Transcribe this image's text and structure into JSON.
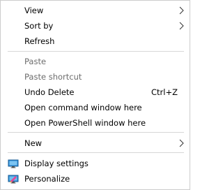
{
  "context_menu": {
    "items": [
      {
        "label": "View",
        "submenu": true
      },
      {
        "label": "Sort by",
        "submenu": true
      },
      {
        "label": "Refresh"
      },
      {
        "label": "Paste",
        "disabled": true
      },
      {
        "label": "Paste shortcut",
        "disabled": true
      },
      {
        "label": "Undo Delete",
        "shortcut": "Ctrl+Z"
      },
      {
        "label": "Open command window here"
      },
      {
        "label": "Open PowerShell window here"
      },
      {
        "label": "New",
        "submenu": true
      },
      {
        "label": "Display settings",
        "icon": "display-settings-icon"
      },
      {
        "label": "Personalize",
        "icon": "personalize-icon"
      }
    ]
  },
  "colors": {
    "disabled_text": "#6d6d6d",
    "separator": "#d7d7d7",
    "border": "#cccccc",
    "monitor_icon": "#2a8ad4"
  }
}
